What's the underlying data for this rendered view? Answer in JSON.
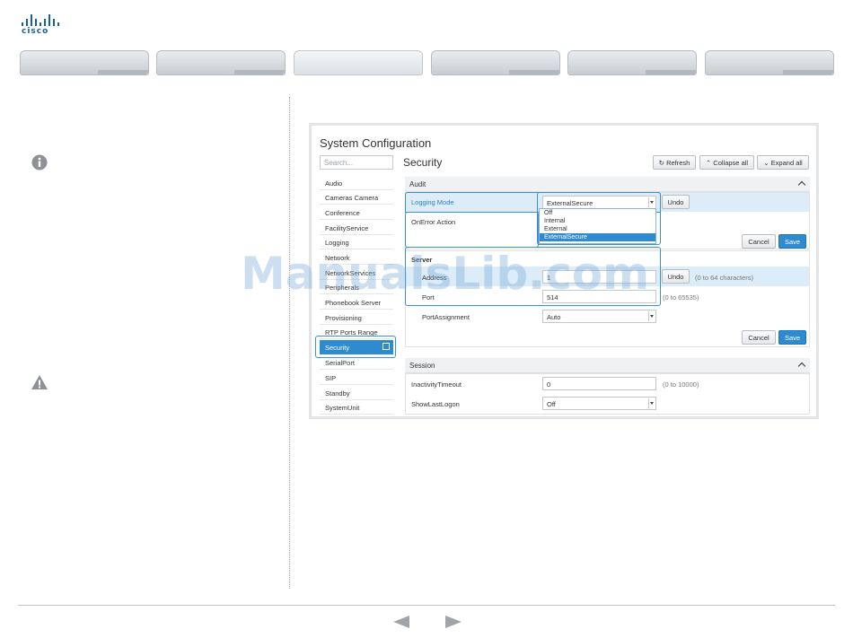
{
  "brand": {
    "logo_text": "cisco"
  },
  "tabs": [
    {
      "label": "",
      "active": false
    },
    {
      "label": "",
      "active": false
    },
    {
      "label": "",
      "active": true
    },
    {
      "label": "",
      "active": false
    },
    {
      "label": "",
      "active": false
    },
    {
      "label": "",
      "active": false
    }
  ],
  "sidebar_icons": [
    "info-icon",
    "warning-icon"
  ],
  "config": {
    "title": "System Configuration",
    "search_placeholder": "Search...",
    "menu": [
      "Audio",
      "Cameras Camera",
      "Conference",
      "FacilityService",
      "Logging",
      "Network",
      "NetworkServices",
      "Peripherals",
      "Phonebook Server",
      "Provisioning",
      "RTP Ports Range",
      "Security",
      "SerialPort",
      "SIP",
      "Standby",
      "SystemUnit"
    ],
    "active_item": "Security",
    "section_title": "Security",
    "toolbar": {
      "refresh": "Refresh",
      "collapse": "Collapse all",
      "expand": "Expand all"
    },
    "audit": {
      "title": "Audit",
      "logging_mode_label": "Logging Mode",
      "logging_mode_value": "ExternalSecure",
      "undo": "Undo",
      "onerror_label": "OnError Action",
      "dropdown_options": [
        "Off",
        "Internal",
        "External",
        "ExternalSecure"
      ],
      "cancel": "Cancel",
      "save": "Save"
    },
    "server": {
      "title": "Server",
      "address_label": "Address",
      "address_value": "1",
      "undo": "Undo",
      "address_hint": "(0 to 64 characters)",
      "port_label": "Port",
      "port_value": "514",
      "port_hint": "(0 to 65535)",
      "portassignment_label": "PortAssignment",
      "portassignment_value": "Auto",
      "cancel": "Cancel",
      "save": "Save"
    },
    "session": {
      "title": "Session",
      "inactivity_label": "InactivityTimeout",
      "inactivity_value": "0",
      "inactivity_hint": "(0 to 10000)",
      "showlast_label": "ShowLastLogon",
      "showlast_value": "Off"
    }
  },
  "watermark": "ManualsLib.com",
  "colors": {
    "accent": "#2e8bd0",
    "brand": "#1c5f8e"
  }
}
